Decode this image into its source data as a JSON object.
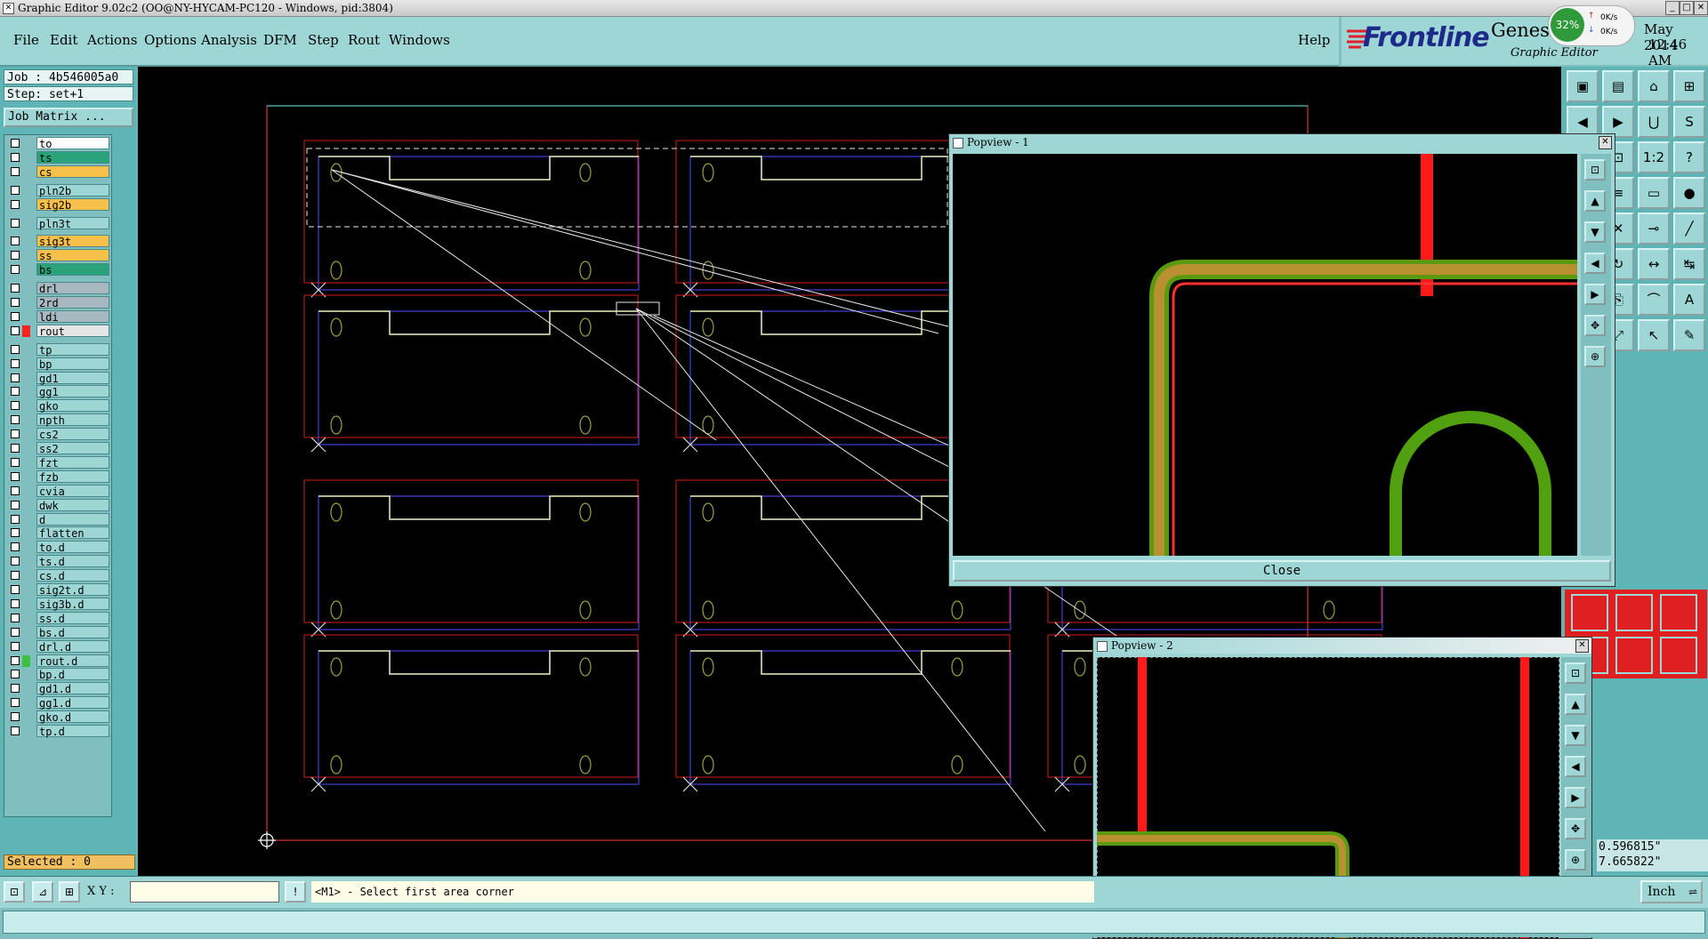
{
  "window": {
    "title": "Graphic Editor 9.02c2 (OO@NY-HYCAM-PC120 - Windows, pid:3804)"
  },
  "menu": [
    "File",
    "Edit",
    "Actions",
    "Options",
    "Analysis",
    "DFM",
    "Step",
    "Rout",
    "Windows"
  ],
  "help_label": "Help",
  "brand": {
    "name": "Frontline",
    "product": "Genesis",
    "subtitle": "Graphic Editor",
    "date": "May 2014",
    "time": "12:46 AM"
  },
  "net_meter": {
    "percent": "32%",
    "up": "0K/s",
    "down": "0K/s"
  },
  "left": {
    "job": "Job : 4b546005a0",
    "step": "Step: set+1",
    "job_matrix": "Job Matrix ...",
    "selected": "Selected : 0",
    "layers": [
      {
        "name": "to",
        "bg": "#ffffff",
        "swatch": ""
      },
      {
        "name": "ts",
        "bg": "#2aa37a",
        "swatch": ""
      },
      {
        "name": "cs",
        "bg": "#f6c04a",
        "swatch": ""
      },
      {
        "name": "pln2b",
        "bg": "#9ed6d6",
        "swatch": ""
      },
      {
        "name": "sig2b",
        "bg": "#f6c04a",
        "swatch": ""
      },
      {
        "name": "pln3t",
        "bg": "#9ed6d6",
        "swatch": ""
      },
      {
        "name": "sig3t",
        "bg": "#f6c04a",
        "swatch": ""
      },
      {
        "name": "ss",
        "bg": "#f6c04a",
        "swatch": ""
      },
      {
        "name": "bs",
        "bg": "#2aa37a",
        "swatch": ""
      },
      {
        "name": "drl",
        "bg": "#a8b8c0",
        "swatch": ""
      },
      {
        "name": "2rd",
        "bg": "#a8b8c0",
        "swatch": ""
      },
      {
        "name": "ldi",
        "bg": "#a8b8c0",
        "swatch": ""
      },
      {
        "name": "rout",
        "bg": "#e6e6e6",
        "swatch": "#ff2020"
      },
      {
        "name": "tp",
        "bg": "#9ed6d6",
        "swatch": ""
      },
      {
        "name": "bp",
        "bg": "#9ed6d6",
        "swatch": ""
      },
      {
        "name": "gd1",
        "bg": "#9ed6d6",
        "swatch": ""
      },
      {
        "name": "gg1",
        "bg": "#9ed6d6",
        "swatch": ""
      },
      {
        "name": "gko",
        "bg": "#9ed6d6",
        "swatch": ""
      },
      {
        "name": "npth",
        "bg": "#9ed6d6",
        "swatch": ""
      },
      {
        "name": "cs2",
        "bg": "#9ed6d6",
        "swatch": ""
      },
      {
        "name": "ss2",
        "bg": "#9ed6d6",
        "swatch": ""
      },
      {
        "name": "fzt",
        "bg": "#9ed6d6",
        "swatch": ""
      },
      {
        "name": "fzb",
        "bg": "#9ed6d6",
        "swatch": ""
      },
      {
        "name": "cvia",
        "bg": "#9ed6d6",
        "swatch": ""
      },
      {
        "name": "dwk",
        "bg": "#9ed6d6",
        "swatch": ""
      },
      {
        "name": "d",
        "bg": "#9ed6d6",
        "swatch": ""
      },
      {
        "name": "flatten",
        "bg": "#9ed6d6",
        "swatch": ""
      },
      {
        "name": "to.d",
        "bg": "#9ed6d6",
        "swatch": ""
      },
      {
        "name": "ts.d",
        "bg": "#9ed6d6",
        "swatch": ""
      },
      {
        "name": "cs.d",
        "bg": "#9ed6d6",
        "swatch": ""
      },
      {
        "name": "sig2t.d",
        "bg": "#9ed6d6",
        "swatch": ""
      },
      {
        "name": "sig3b.d",
        "bg": "#9ed6d6",
        "swatch": ""
      },
      {
        "name": "ss.d",
        "bg": "#9ed6d6",
        "swatch": ""
      },
      {
        "name": "bs.d",
        "bg": "#9ed6d6",
        "swatch": ""
      },
      {
        "name": "drl.d",
        "bg": "#9ed6d6",
        "swatch": ""
      },
      {
        "name": "rout.d",
        "bg": "#9ed6d6",
        "swatch": "#40c040"
      },
      {
        "name": "bp.d",
        "bg": "#9ed6d6",
        "swatch": ""
      },
      {
        "name": "gd1.d",
        "bg": "#9ed6d6",
        "swatch": ""
      },
      {
        "name": "gg1.d",
        "bg": "#9ed6d6",
        "swatch": ""
      },
      {
        "name": "gko.d",
        "bg": "#9ed6d6",
        "swatch": ""
      },
      {
        "name": "tp.d",
        "bg": "#9ed6d6",
        "swatch": ""
      }
    ]
  },
  "popview1": {
    "title": "Popview - 1",
    "close_label": "Close"
  },
  "popview2": {
    "title": "Popview - 2"
  },
  "coords": {
    "x": "0.596815\"",
    "y": "7.665822\""
  },
  "bottom": {
    "xy_label": "X Y :",
    "xy_value": "",
    "prompt": "<M1> - Select first area corner",
    "units": "Inch"
  },
  "tool_icons": [
    "snapshot-icon",
    "save-icon",
    "home-icon",
    "window-icon",
    "undo-icon",
    "redo-icon",
    "rout-icon",
    "s-icon",
    "zoom-area-icon",
    "ratio-icon",
    "help-icon",
    "layers-icon",
    "ruler-icon",
    "pad-icon",
    "cross-icon",
    "connect-icon",
    "line-icon",
    "rotate-icon",
    "flip-icon",
    "measure-icon",
    "copy-icon",
    "arc-icon",
    "text-icon",
    "text2-icon",
    "cursor-icon",
    "move-icon",
    "edit-icon"
  ],
  "colors": {
    "canvas": "#000000",
    "panel": "#9ed6d6",
    "accent": "#5fb5b5"
  }
}
